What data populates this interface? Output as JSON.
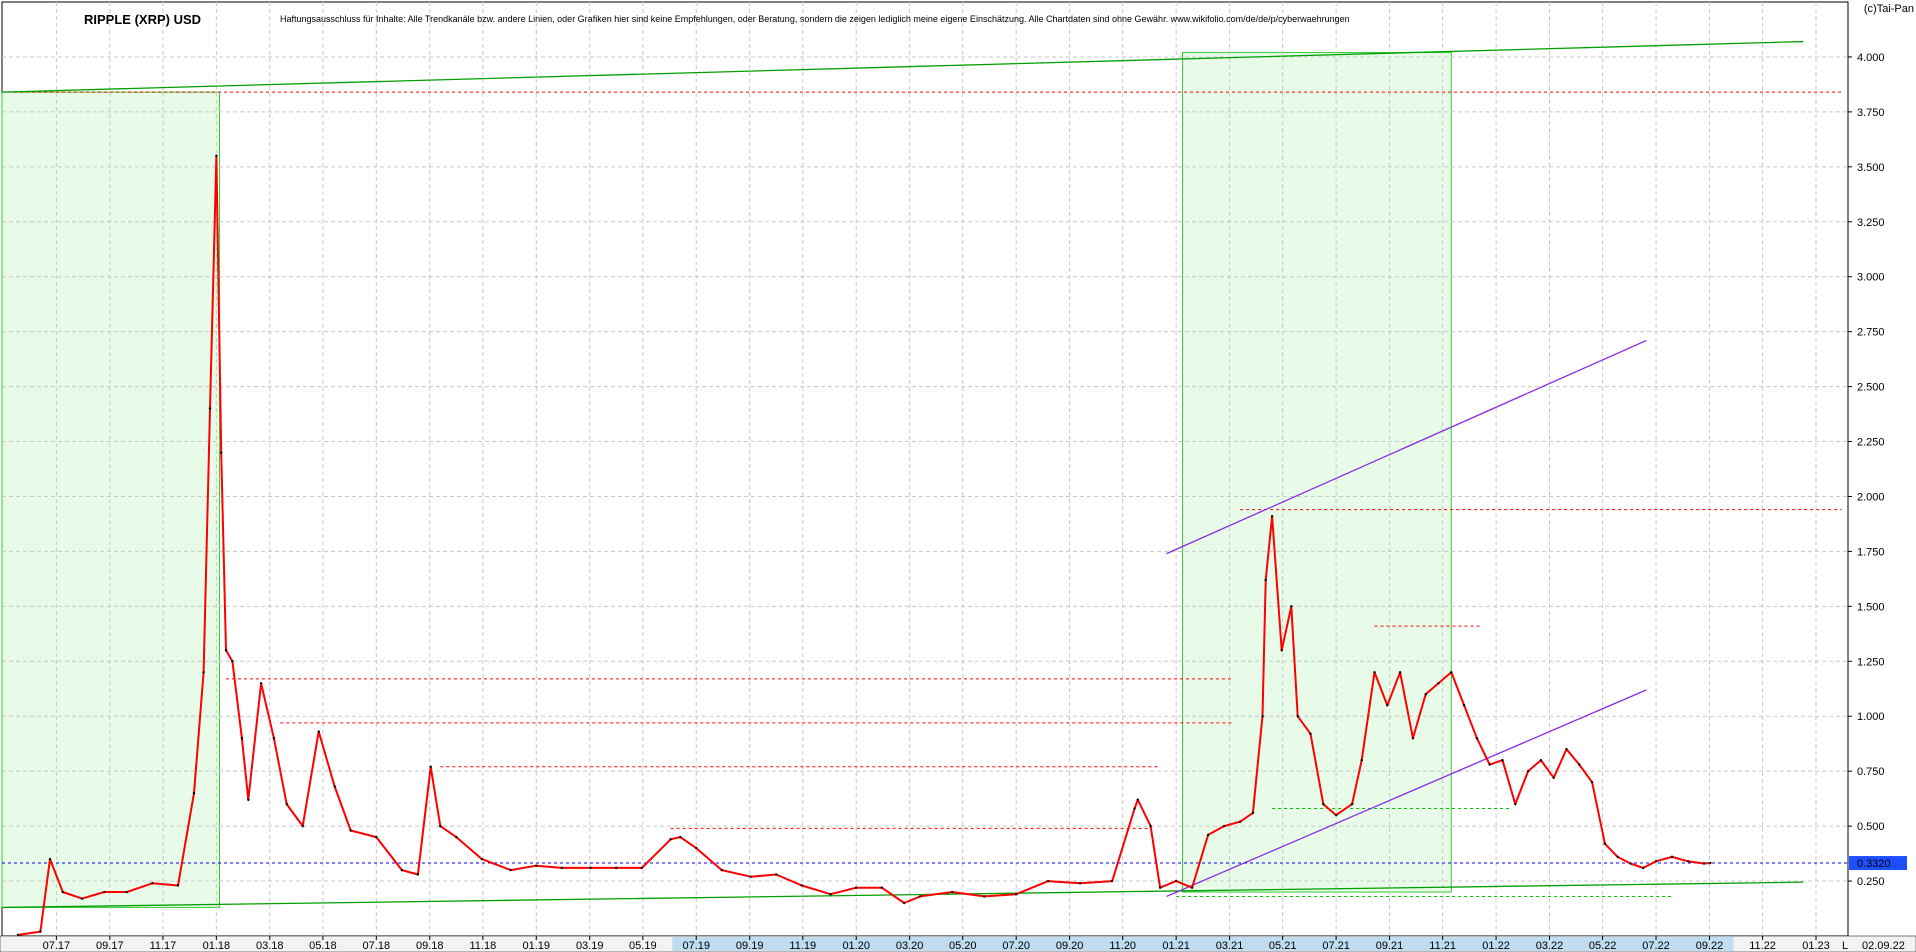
{
  "header": {
    "title": "RIPPLE (XRP) USD",
    "disclaimer": "Haftungsausschluss für Inhalte: Alle Trendkanäle bzw. andere Linien, oder Grafiken hier sind keine Empfehlungen, oder Beratung, sondern die zeigen lediglich meine eigene Einschätzung. Alle Chartdaten sind ohne Gewähr.  www.wikifolio.com/de/de/p/cyberwaehrungen",
    "copyright": "(c)Tai-Pan"
  },
  "colors": {
    "price": "#ff0000",
    "grid": "#c8c8c8",
    "trend_green": "#00a000",
    "channel_purple": "#8a2be2",
    "resistance_red": "#ff0000",
    "current_blue": "#0000ff",
    "zone_fill": "#e8fbe8",
    "axis_highlight": "#bfdcf0"
  },
  "chart_data": {
    "type": "line",
    "title": "RIPPLE (XRP) USD",
    "xlabel": "",
    "ylabel": "",
    "ylim": [
      0.0,
      4.25
    ],
    "y_ticks": [
      "4.000",
      "3.750",
      "3.500",
      "3.250",
      "3.000",
      "2.750",
      "2.500",
      "2.250",
      "2.000",
      "1.750",
      "1.500",
      "1.250",
      "1.000",
      "0.750",
      "0.500",
      "0.250"
    ],
    "y_tick_values": [
      4.0,
      3.75,
      3.5,
      3.25,
      3.0,
      2.75,
      2.5,
      2.25,
      2.0,
      1.75,
      1.5,
      1.25,
      1.0,
      0.75,
      0.5,
      0.25
    ],
    "x_ticks": [
      "07.17",
      "09.17",
      "11.17",
      "01.18",
      "03.18",
      "05.18",
      "07.18",
      "09.18",
      "11.18",
      "01.19",
      "03.19",
      "05.19",
      "07.19",
      "09.19",
      "11.19",
      "01.20",
      "03.20",
      "05.20",
      "07.20",
      "09.20",
      "11.20",
      "01.21",
      "03.21",
      "05.21",
      "07.21",
      "09.21",
      "11.21",
      "01.22",
      "03.22",
      "05.22",
      "07.22",
      "09.22",
      "11.22",
      "01.23"
    ],
    "x_tick_values": [
      2017.5,
      2017.667,
      2017.833,
      2018.0,
      2018.167,
      2018.333,
      2018.5,
      2018.667,
      2018.833,
      2019.0,
      2019.167,
      2019.333,
      2019.5,
      2019.667,
      2019.833,
      2020.0,
      2020.167,
      2020.333,
      2020.5,
      2020.667,
      2020.833,
      2021.0,
      2021.167,
      2021.333,
      2021.5,
      2021.667,
      2021.833,
      2022.0,
      2022.167,
      2022.333,
      2022.5,
      2022.667,
      2022.833,
      2023.0
    ],
    "highlighted_x_range": [
      "07.19",
      "09.22"
    ],
    "x_axis_end_label": "02.09.22",
    "x_axis_marker": "L",
    "current_value_label": "0.3320",
    "current_value": 0.332,
    "series": [
      {
        "x": [
          2017.38,
          2017.45,
          2017.48,
          2017.52,
          2017.58,
          2017.65,
          2017.72,
          2017.8,
          2017.88,
          2017.93,
          2017.96,
          2017.98,
          2018.0,
          2018.015,
          2018.03,
          2018.05,
          2018.08,
          2018.1,
          2018.14,
          2018.18,
          2018.22,
          2018.27,
          2018.32,
          2018.37,
          2018.42,
          2018.5,
          2018.58,
          2018.63,
          2018.67,
          2018.7,
          2018.75,
          2018.83,
          2018.92,
          2019.0,
          2019.08,
          2019.17,
          2019.25,
          2019.33,
          2019.42,
          2019.45,
          2019.5,
          2019.58,
          2019.67,
          2019.75,
          2019.83,
          2019.92,
          2020.0,
          2020.08,
          2020.15,
          2020.2,
          2020.3,
          2020.4,
          2020.5,
          2020.6,
          2020.7,
          2020.8,
          2020.87,
          2020.88,
          2020.92,
          2020.95,
          2021.0,
          2021.05,
          2021.1,
          2021.15,
          2021.2,
          2021.24,
          2021.27,
          2021.28,
          2021.3,
          2021.33,
          2021.36,
          2021.38,
          2021.42,
          2021.46,
          2021.5,
          2021.55,
          2021.58,
          2021.62,
          2021.66,
          2021.7,
          2021.74,
          2021.78,
          2021.82,
          2021.86,
          2021.9,
          2021.94,
          2021.98,
          2022.02,
          2022.06,
          2022.1,
          2022.14,
          2022.18,
          2022.22,
          2022.26,
          2022.3,
          2022.34,
          2022.38,
          2022.42,
          2022.46,
          2022.5,
          2022.55,
          2022.6,
          2022.65,
          2022.67
        ],
        "values": [
          0.005,
          0.02,
          0.35,
          0.2,
          0.17,
          0.2,
          0.2,
          0.24,
          0.23,
          0.65,
          1.2,
          2.4,
          3.55,
          2.2,
          1.3,
          1.25,
          0.9,
          0.62,
          1.15,
          0.9,
          0.6,
          0.5,
          0.93,
          0.68,
          0.48,
          0.45,
          0.3,
          0.28,
          0.77,
          0.5,
          0.45,
          0.35,
          0.3,
          0.32,
          0.31,
          0.31,
          0.31,
          0.31,
          0.44,
          0.45,
          0.4,
          0.3,
          0.27,
          0.28,
          0.23,
          0.19,
          0.22,
          0.22,
          0.15,
          0.18,
          0.2,
          0.18,
          0.19,
          0.25,
          0.24,
          0.25,
          0.58,
          0.62,
          0.5,
          0.22,
          0.25,
          0.22,
          0.46,
          0.5,
          0.52,
          0.56,
          1.0,
          1.62,
          1.91,
          1.3,
          1.5,
          1.0,
          0.92,
          0.6,
          0.55,
          0.6,
          0.8,
          1.2,
          1.05,
          1.2,
          0.9,
          1.1,
          1.15,
          1.2,
          1.05,
          0.9,
          0.78,
          0.8,
          0.6,
          0.75,
          0.8,
          0.72,
          0.85,
          0.78,
          0.7,
          0.42,
          0.36,
          0.33,
          0.31,
          0.34,
          0.36,
          0.34,
          0.33,
          0.332
        ]
      }
    ],
    "annotations": {
      "resistance_lines": [
        3.84,
        1.94,
        1.41,
        1.17,
        0.97,
        0.77,
        0.49
      ],
      "support_dotted_lines": [
        0.58,
        0.18
      ],
      "ascending_support_line": {
        "x": [
          2017.33,
          2022.96
        ],
        "y": [
          0.13,
          0.245
        ]
      },
      "ascending_top_line": {
        "x": [
          2017.33,
          2022.96
        ],
        "y": [
          3.84,
          4.07
        ]
      },
      "purple_channel_upper": {
        "x": [
          2020.97,
          2022.47
        ],
        "y": [
          1.74,
          2.71
        ]
      },
      "purple_channel_lower": {
        "x": [
          2020.97,
          2022.47
        ],
        "y": [
          0.18,
          1.12
        ]
      },
      "highlight_zones": [
        [
          2017.33,
          2018.01
        ],
        [
          2021.02,
          2021.86
        ]
      ]
    }
  }
}
